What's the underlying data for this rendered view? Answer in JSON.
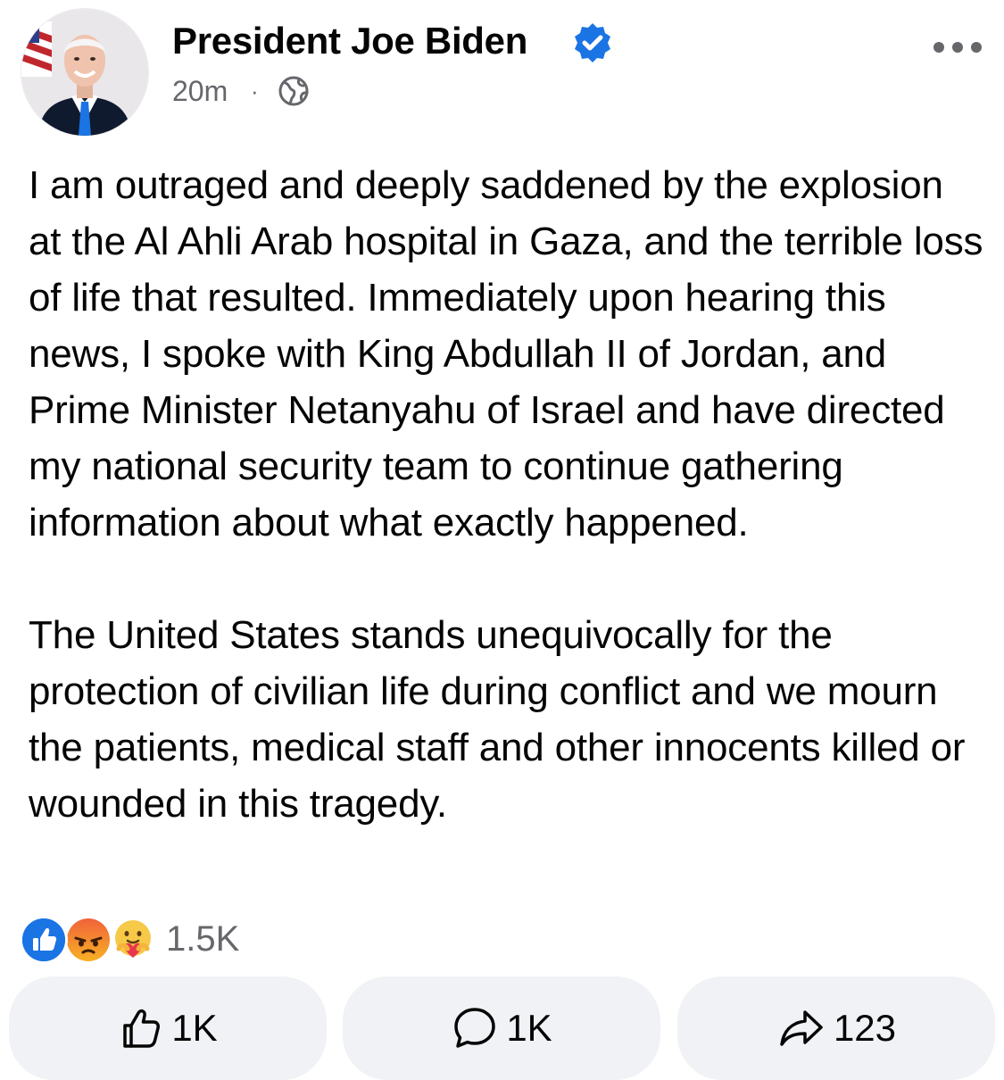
{
  "post": {
    "author": "President Joe Biden",
    "verified": true,
    "timestamp": "20m",
    "separator": "·",
    "audience_icon": "globe-icon",
    "more_icon": "more-horizontal-icon",
    "paragraphs": [
      "I am outraged and deeply saddened by the explosion at the Al Ahli Arab hospital in Gaza, and the terrible loss of life that resulted. Immediately upon hearing this news, I spoke with King Abdullah II of Jordan, and Prime Minister Netanyahu of Israel and have directed my national security team to continue gathering information about what exactly happened.",
      "The United States stands unequivocally for the protection of civilian life during conflict and we mourn the patients, medical staff and other innocents killed or wounded in this tragedy."
    ]
  },
  "reactions": {
    "icons": [
      "like-reaction-icon",
      "angry-reaction-icon",
      "care-reaction-icon"
    ],
    "count": "1.5K"
  },
  "actions": {
    "like": {
      "icon": "thumbs-up-icon",
      "count": "1K"
    },
    "comment": {
      "icon": "comment-bubble-icon",
      "count": "1K"
    },
    "share": {
      "icon": "share-arrow-icon",
      "count": "123"
    }
  },
  "colors": {
    "verified_blue": "#1b74e4",
    "secondary_text": "#65676b",
    "button_bg": "#f0f2f5",
    "angry_orange": "#f0623a"
  }
}
